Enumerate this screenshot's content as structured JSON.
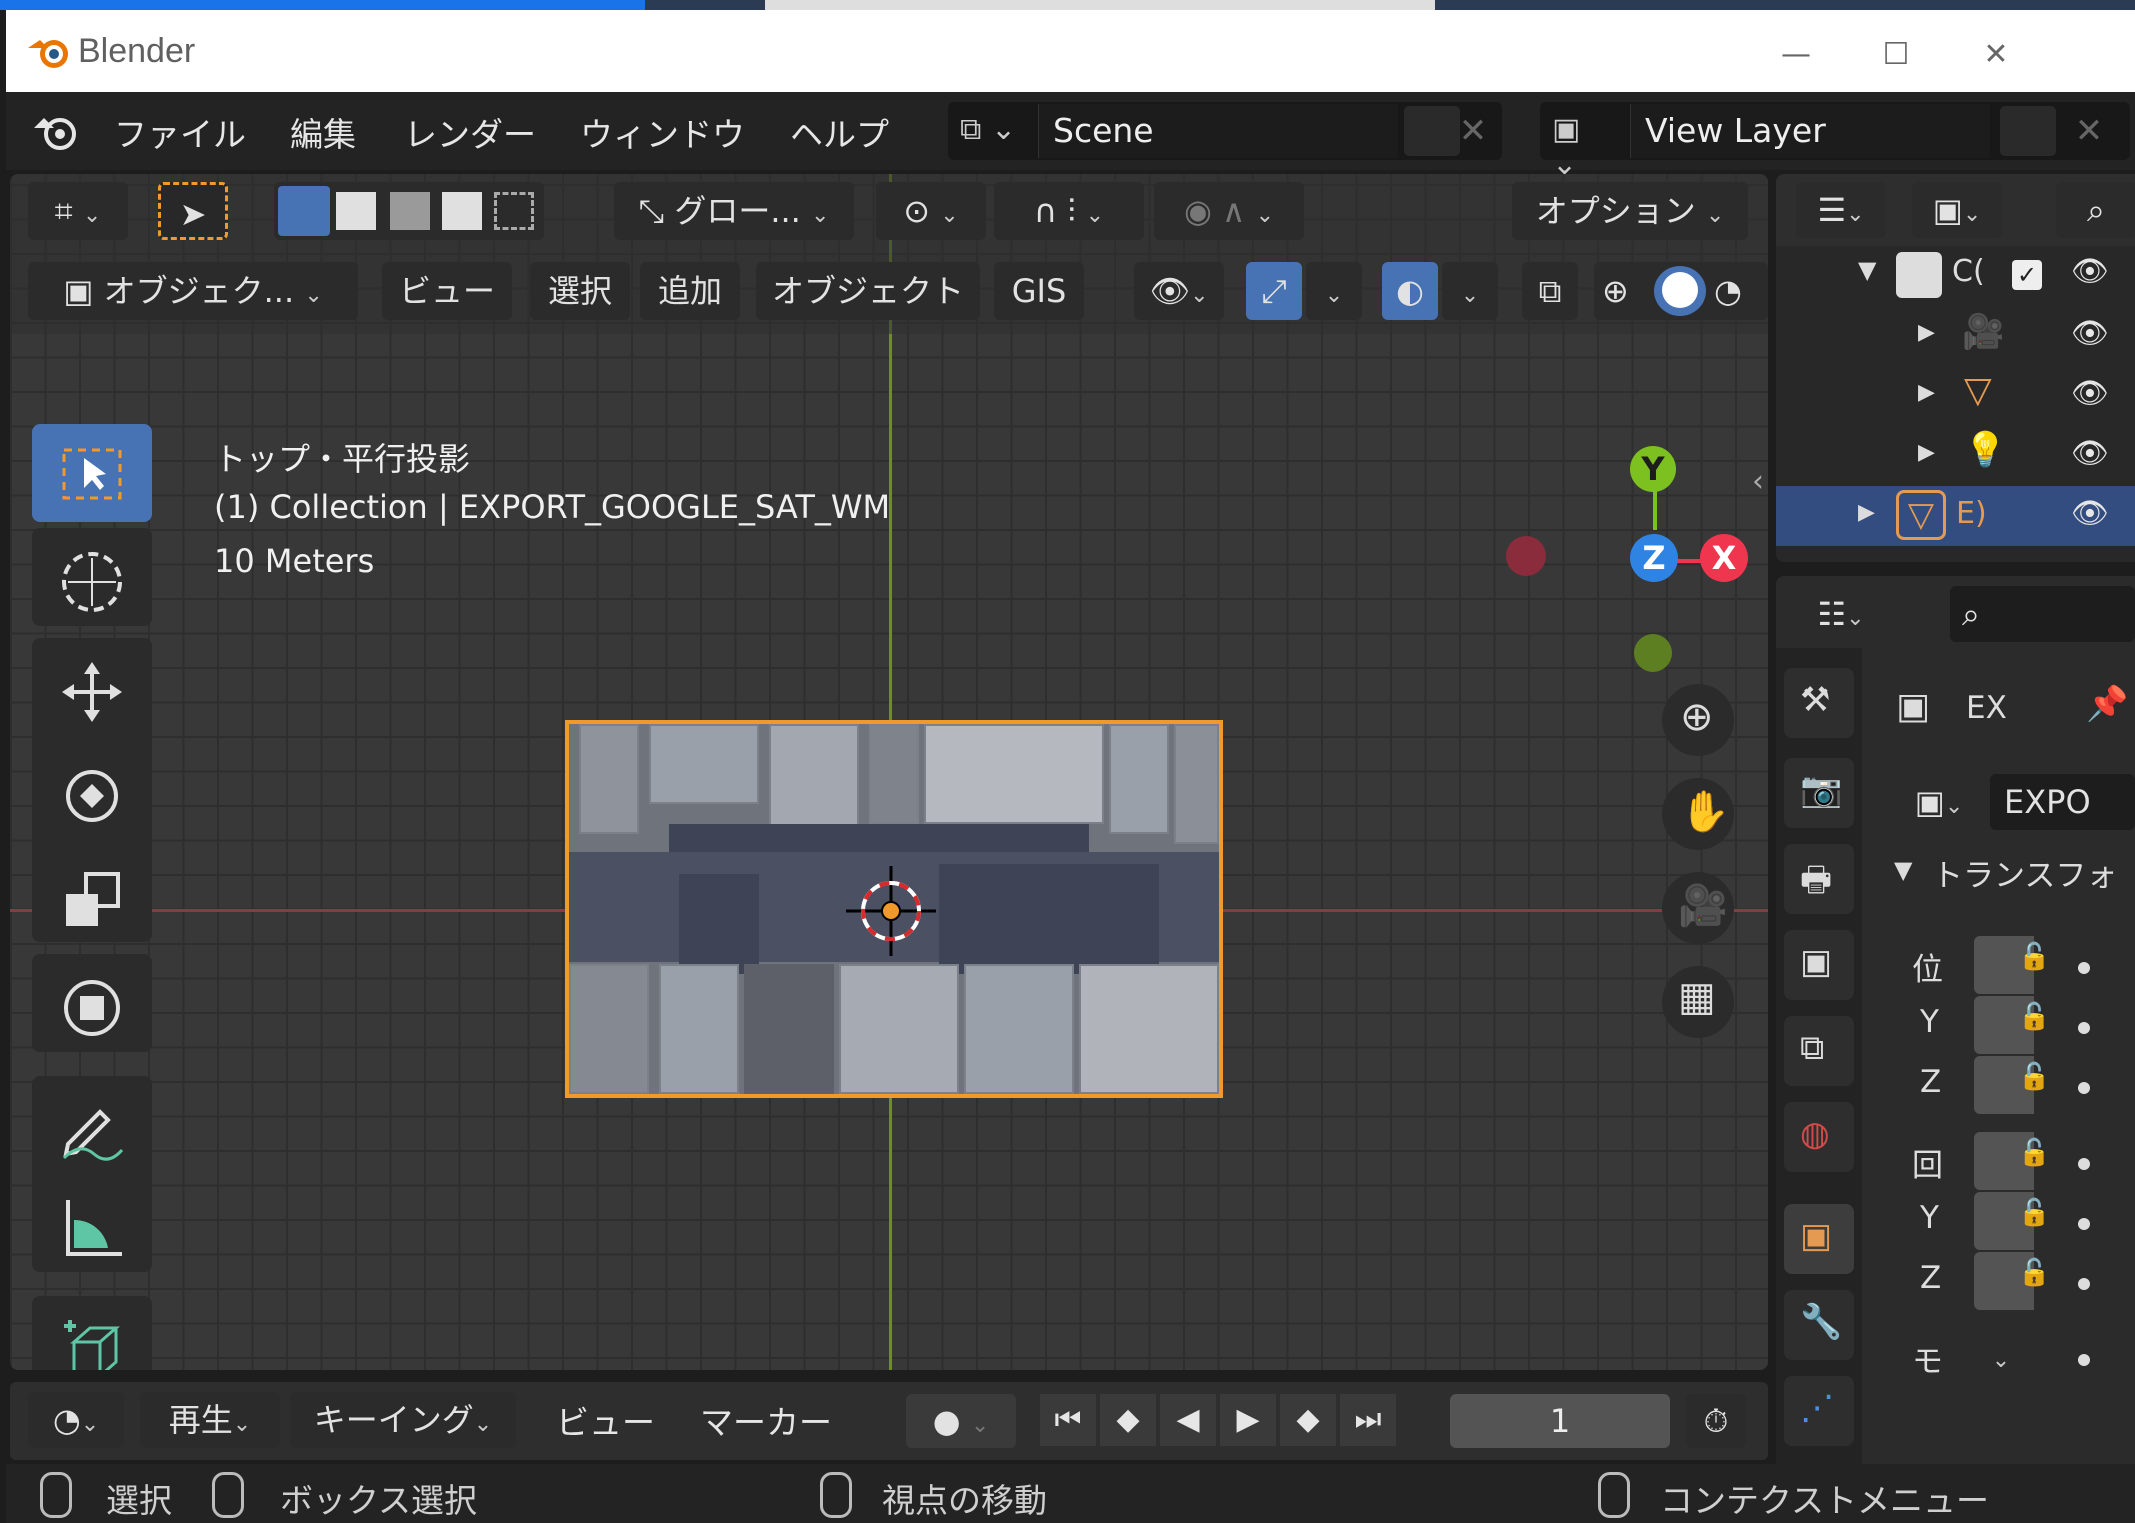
{
  "window": {
    "title": "Blender",
    "minimize": "—",
    "maximize": "☐",
    "close": "✕"
  },
  "menu": {
    "file": "ファイル",
    "edit": "編集",
    "render": "レンダー",
    "window": "ウィンドウ",
    "help": "ヘルプ"
  },
  "scene": {
    "name": "Scene"
  },
  "view_layer": {
    "name": "View Layer"
  },
  "viewport_header": {
    "transform_orientation": "グロー...",
    "options": "オプション",
    "mode": "オブジェク...",
    "view": "ビュー",
    "select": "選択",
    "add": "追加",
    "object": "オブジェクト",
    "gis": "GIS"
  },
  "overlay": {
    "view_name": "トップ・平行投影",
    "collection_info": "(1) Collection | EXPORT_GOOGLE_SAT_WM",
    "scale": "10 Meters"
  },
  "gizmo": {
    "y": "Y",
    "z": "Z",
    "x": "X"
  },
  "timeline": {
    "playback": "再生",
    "keying": "キーイング",
    "view": "ビュー",
    "marker": "マーカー",
    "current_frame": "1"
  },
  "statusbar": {
    "select": "選択",
    "box_select": "ボックス選択",
    "rotate_view": "視点の移動",
    "context_menu": "コンテクストメニュー"
  },
  "outliner": {
    "collection_label": "C(",
    "selected_object": "E)"
  },
  "properties": {
    "object_name_short": "EX",
    "object_field": "EXPO",
    "transform_panel": "トランスフォ",
    "loc_label": "位",
    "loc_y": "Y",
    "loc_z": "Z",
    "rot_label": "回",
    "rot_y": "Y",
    "rot_z": "Z",
    "mode_label": "モ"
  },
  "colors": {
    "accent_blue": "#4772b3",
    "select_orange": "#f19a2b",
    "axis_x": "#f0354f",
    "axis_y": "#7cc11f",
    "axis_z": "#2f84e3"
  }
}
